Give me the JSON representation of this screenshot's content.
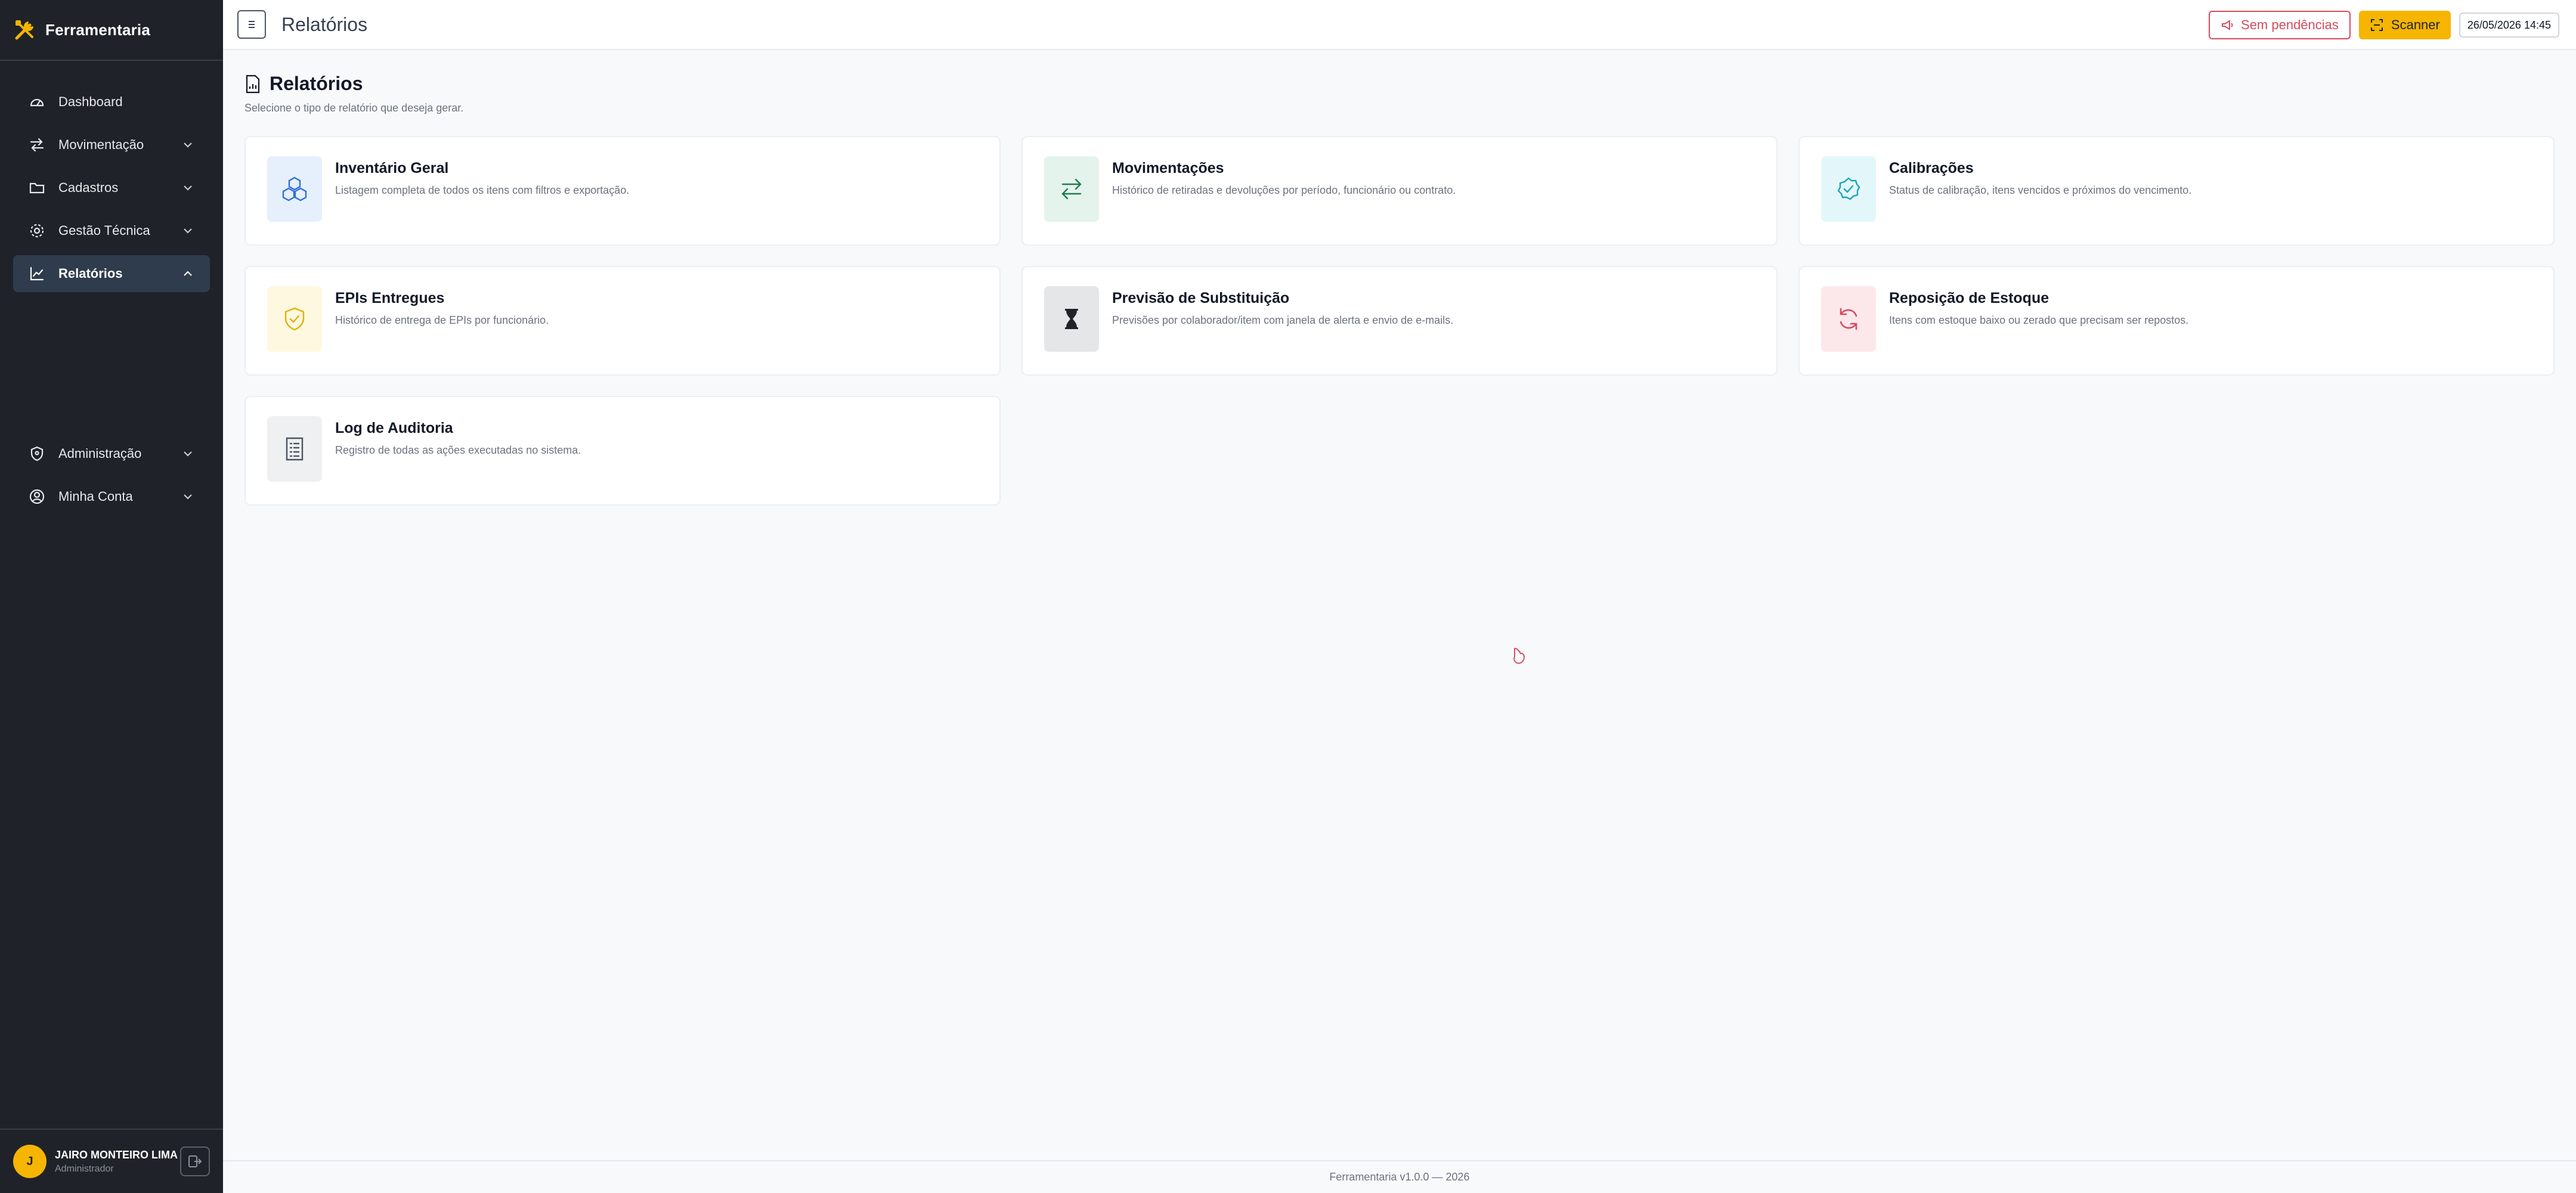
{
  "app": {
    "name": "Ferramentaria"
  },
  "sidebar": {
    "items": [
      {
        "label": "Dashboard",
        "icon": "dashboard-icon",
        "expandable": false
      },
      {
        "label": "Movimentação",
        "icon": "arrows-icon",
        "expandable": true
      },
      {
        "label": "Cadastros",
        "icon": "folder-icon",
        "expandable": true
      },
      {
        "label": "Gestão Técnica",
        "icon": "gear-icon",
        "expandable": true
      },
      {
        "label": "Relatórios",
        "icon": "chart-icon",
        "expandable": true,
        "active": true
      },
      {
        "label": "Administração",
        "icon": "shield-icon",
        "expandable": true
      },
      {
        "label": "Minha Conta",
        "icon": "user-circle-icon",
        "expandable": true
      }
    ]
  },
  "user": {
    "initial": "J",
    "name": "JAIRO MONTEIRO LIMA",
    "role": "Administrador"
  },
  "header": {
    "title": "Relatórios",
    "pending_label": "Sem pendências",
    "scanner_label": "Scanner",
    "datetime": "26/05/2026 14:45"
  },
  "page": {
    "title": "Relatórios",
    "subtitle": "Selecione o tipo de relatório que deseja gerar."
  },
  "cards": [
    {
      "title": "Inventário Geral",
      "desc": "Listagem completa de todos os itens com filtros e exportação.",
      "icon": "cubes-icon",
      "color": "#2f6fd6",
      "bg": "#e6f0fd"
    },
    {
      "title": "Movimentações",
      "desc": "Histórico de retiradas e devoluções por período, funcionário ou contrato.",
      "icon": "swap-arrows-icon",
      "color": "#1f7a4d",
      "bg": "#e4f4ec"
    },
    {
      "title": "Calibrações",
      "desc": "Status de calibração, itens vencidos e próximos do vencimento.",
      "icon": "badge-check-icon",
      "color": "#1aa3b8",
      "bg": "#e3f7fa"
    },
    {
      "title": "EPIs Entregues",
      "desc": "Histórico de entrega de EPIs por funcionário.",
      "icon": "shield-check-icon",
      "color": "#e0b000",
      "bg": "#fff8e0"
    },
    {
      "title": "Previsão de Substituição",
      "desc": "Previsões por colaborador/item com janela de alerta e envio de e-mails.",
      "icon": "hourglass-icon",
      "color": "#1f2329",
      "bg": "#e5e6e8"
    },
    {
      "title": "Reposição de Estoque",
      "desc": "Itens com estoque baixo ou zerado que precisam ser repostos.",
      "icon": "refresh-icon",
      "color": "#d94a5e",
      "bg": "#fce8eb"
    },
    {
      "title": "Log de Auditoria",
      "desc": "Registro de todas as ações executadas no sistema.",
      "icon": "document-list-icon",
      "color": "#4b5563",
      "bg": "#eef0f2"
    }
  ],
  "footer": {
    "text": "Ferramentaria v1.0.0 — 2026"
  }
}
